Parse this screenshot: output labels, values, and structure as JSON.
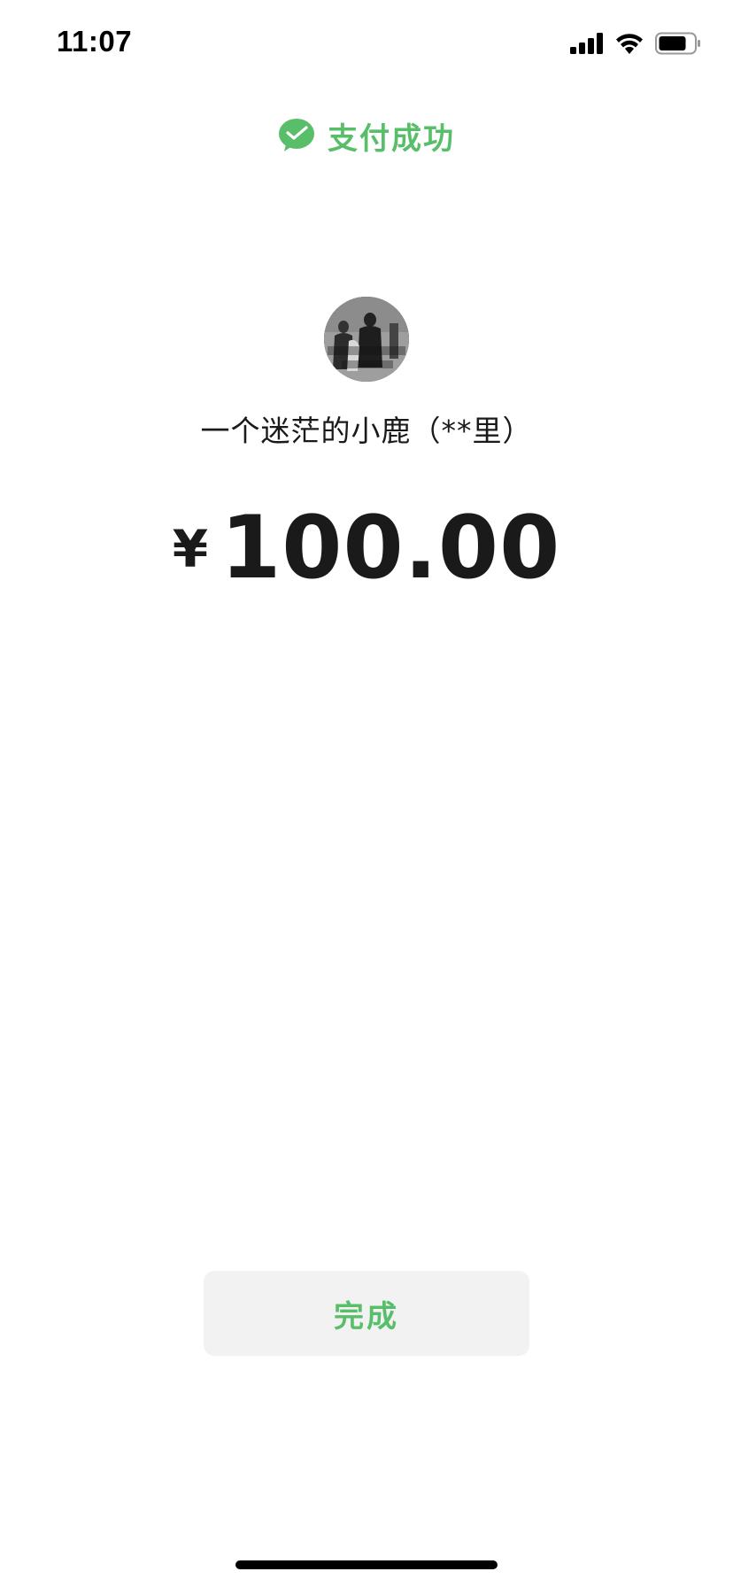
{
  "status_bar": {
    "time": "11:07",
    "signal_icon": "signal-bars-icon",
    "wifi_icon": "wifi-icon",
    "battery_icon": "battery-icon"
  },
  "header": {
    "logo_icon": "wechat-pay-logo-icon",
    "title": "支付成功",
    "accent_color": "#58be6a"
  },
  "payee": {
    "avatar_icon": "avatar-photo",
    "name": "一个迷茫的小鹿（**里）"
  },
  "payment": {
    "currency_symbol": "¥",
    "amount": "100.00"
  },
  "actions": {
    "done_label": "完成"
  }
}
